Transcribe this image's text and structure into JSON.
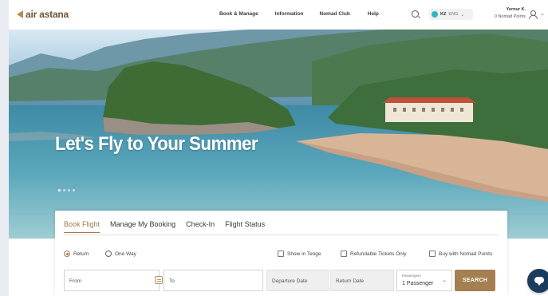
{
  "brand": {
    "name": "air astana",
    "accent": "#a37f52"
  },
  "nav": {
    "items": [
      "Book & Manage",
      "Information",
      "Nomad Club",
      "Help"
    ]
  },
  "header": {
    "search_icon": "search-icon",
    "lang": {
      "country": "KZ",
      "language": "ENG"
    },
    "user": {
      "name": "Yernur K.",
      "points": "0 Nomad Points"
    }
  },
  "hero": {
    "headline": "Let's Fly to Your Summer",
    "slides": 4,
    "active_slide": 1
  },
  "booking": {
    "tabs": [
      "Book Flight",
      "Manage My Booking",
      "Check-In",
      "Flight Status"
    ],
    "active_tab": "Book Flight",
    "trip_types": [
      "Return",
      "One Way"
    ],
    "selected_trip": "Return",
    "options": [
      "Show in Tenge",
      "Refundable Tickets Only",
      "Buy with Nomad Points"
    ],
    "from_placeholder": "From",
    "to_placeholder": "To",
    "departure_placeholder": "Departure Date",
    "return_placeholder": "Return Date",
    "passengers_label": "Passengers",
    "passengers_value": "1 Passenger",
    "search_label": "SEARCH"
  }
}
